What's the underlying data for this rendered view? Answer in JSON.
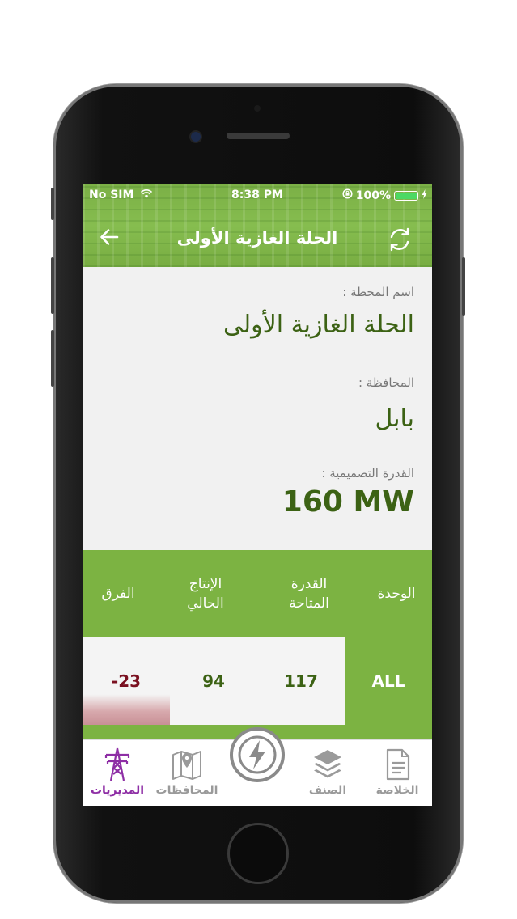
{
  "status_bar": {
    "carrier": "No SIM",
    "time": "8:38 PM",
    "battery": "100%"
  },
  "navbar": {
    "title": "الحلة الغازية الأولى"
  },
  "station": {
    "name_label": "اسم المحطة :",
    "name_value": "الحلة الغازية الأولى",
    "province_label": "المحافظة :",
    "province_value": "بابل",
    "capacity_label": "القدرة التصميمية :",
    "capacity_value": "160 MW"
  },
  "table": {
    "headers": [
      "الوحدة",
      "القدرة المتاحة",
      "الإنتاج الحالي",
      "الفرق"
    ],
    "row": {
      "unit": "ALL",
      "available": "117",
      "current": "94",
      "diff": "-23"
    }
  },
  "tabs": [
    {
      "label": "الخلاصة",
      "icon": "document-icon"
    },
    {
      "label": "الصنف",
      "icon": "layers-icon"
    },
    {
      "label": "",
      "icon": "lightning-icon"
    },
    {
      "label": "المحافظات",
      "icon": "map-icon"
    },
    {
      "label": "المديريات",
      "icon": "power-tower-icon",
      "active": true
    }
  ],
  "colors": {
    "brand_green": "#7cb342",
    "value_green": "#3c6214",
    "active_tab": "#8e2ea5",
    "negative": "#7a1020"
  }
}
